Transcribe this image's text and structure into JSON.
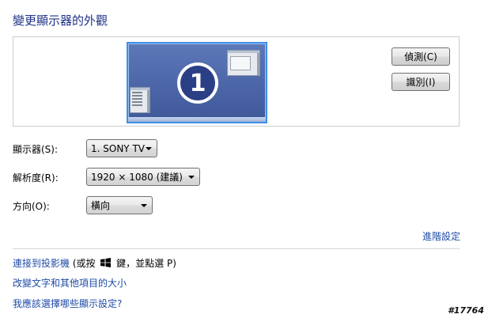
{
  "page": {
    "title": "變更顯示器的外觀"
  },
  "preview": {
    "monitor_number": "1",
    "detect_button": "偵測(C)",
    "identify_button": "識別(I)"
  },
  "settings": {
    "display_label": "顯示器(S):",
    "display_value": "1. SONY TV",
    "resolution_label": "解析度(R):",
    "resolution_value": "1920 × 1080 (建議)",
    "orientation_label": "方向(O):",
    "orientation_value": "橫向"
  },
  "links": {
    "advanced": "進階設定",
    "projector": "連接到投影機",
    "projector_hint_prefix": " (或按 ",
    "projector_hint_suffix": " 鍵，並點選 P)",
    "text_size": "改變文字和其他項目的大小",
    "which_settings": "我應該選擇哪些顯示設定?"
  },
  "watermark": "#17764",
  "icons": {
    "windows_logo": "windows-logo-icon"
  }
}
